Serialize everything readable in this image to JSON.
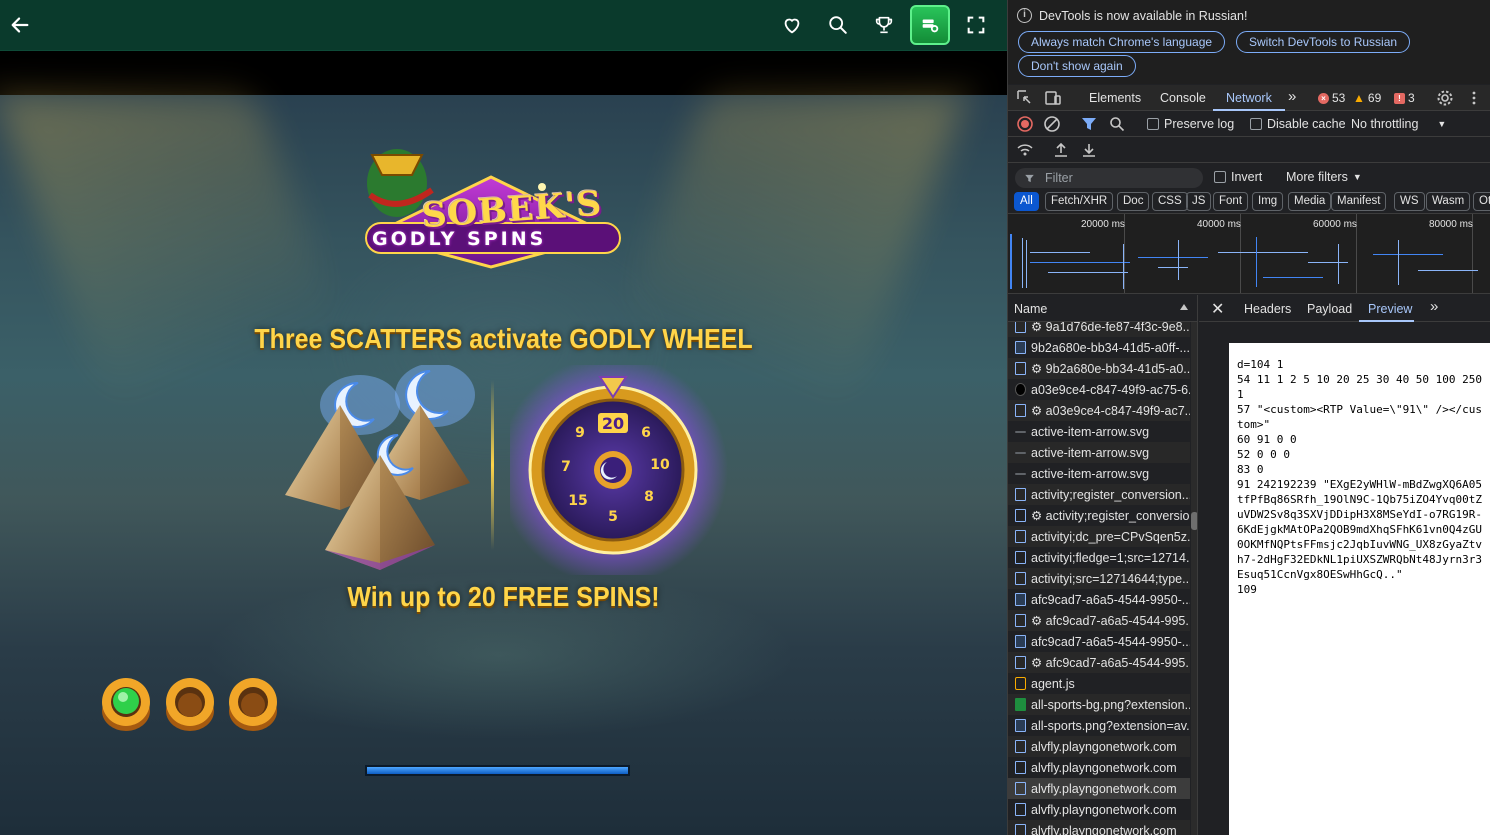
{
  "site_header": {
    "icons": [
      "back-arrow-icon",
      "heart-icon",
      "search-icon",
      "trophy-icon",
      "wallet-icon",
      "fullscreen-icon"
    ],
    "accent": "#0a3a2c",
    "wallet_color": "#1fa84a"
  },
  "game": {
    "logo_line1": "SOBEK'S",
    "logo_line2": "GODLY SPINS",
    "headline": "Three SCATTERS activate GODLY WHEEL",
    "wheel_top_value": "20",
    "wheel_values": [
      "9",
      "6",
      "10",
      "8",
      "5",
      "15",
      "7"
    ],
    "subline": "Win up to 20 FREE SPINS!",
    "tokens": [
      "green",
      "gold",
      "gold"
    ],
    "loading_progress": 1.0
  },
  "devtools": {
    "infobar": {
      "message": "DevTools is now available in Russian!",
      "button_match": "Always match Chrome's language",
      "button_switch": "Switch DevTools to Russian",
      "button_dismiss": "Don't show again"
    },
    "tabs": {
      "elements": "Elements",
      "console": "Console",
      "network": "Network",
      "errors": "53",
      "warnings": "69",
      "issues": "3"
    },
    "toolbar": {
      "preserve_log": "Preserve log",
      "disable_cache": "Disable cache",
      "throttling": "No throttling"
    },
    "filter": {
      "placeholder": "Filter",
      "invert": "Invert",
      "more_filters": "More filters"
    },
    "types": [
      "All",
      "Fetch/XHR",
      "Doc",
      "CSS",
      "JS",
      "Font",
      "Img",
      "Media",
      "Manifest",
      "WS",
      "Wasm",
      "Ot"
    ],
    "timeline_ticks": [
      "20000 ms",
      "40000 ms",
      "60000 ms",
      "80000 ms"
    ],
    "list": {
      "name_header": "Name",
      "rows": [
        {
          "icon": "doc",
          "label": "⚙ 9a1d76de-fe87-4f3c-9e8..."
        },
        {
          "icon": "img",
          "label": "9b2a680e-bb34-41d5-a0ff-..."
        },
        {
          "icon": "doc",
          "label": "⚙ 9b2a680e-bb34-41d5-a0..."
        },
        {
          "icon": "dark",
          "label": "a03e9ce4-c847-49f9-ac75-6..."
        },
        {
          "icon": "doc",
          "label": "⚙ a03e9ce4-c847-49f9-ac7..."
        },
        {
          "icon": "dash",
          "label": "active-item-arrow.svg"
        },
        {
          "icon": "dash",
          "label": "active-item-arrow.svg"
        },
        {
          "icon": "dash",
          "label": "active-item-arrow.svg"
        },
        {
          "icon": "doc",
          "label": "activity;register_conversion..."
        },
        {
          "icon": "doc",
          "label": "⚙ activity;register_conversio..."
        },
        {
          "icon": "doc",
          "label": "activityi;dc_pre=CPvSqen5z..."
        },
        {
          "icon": "doc",
          "label": "activityi;fledge=1;src=12714..."
        },
        {
          "icon": "doc",
          "label": "activityi;src=12714644;type..."
        },
        {
          "icon": "img",
          "label": "afc9cad7-a6a5-4544-9950-..."
        },
        {
          "icon": "doc",
          "label": "⚙ afc9cad7-a6a5-4544-995..."
        },
        {
          "icon": "img",
          "label": "afc9cad7-a6a5-4544-9950-..."
        },
        {
          "icon": "doc",
          "label": "⚙ afc9cad7-a6a5-4544-995..."
        },
        {
          "icon": "script",
          "label": "agent.js"
        },
        {
          "icon": "green",
          "label": "all-sports-bg.png?extension..."
        },
        {
          "icon": "img",
          "label": "all-sports.png?extension=av..."
        },
        {
          "icon": "doc",
          "label": "alvfly.playngonetwork.com"
        },
        {
          "icon": "doc",
          "label": "alvfly.playngonetwork.com"
        },
        {
          "icon": "doc",
          "label": "alvfly.playngonetwork.com"
        },
        {
          "icon": "doc",
          "label": "alvfly.playngonetwork.com"
        },
        {
          "icon": "doc",
          "label": "alvfly.playngonetwork.com"
        }
      ]
    },
    "detail": {
      "headers": "Headers",
      "payload": "Payload",
      "preview": "Preview",
      "preview_text": "d=104 1\n54 11 1 2 5 10 20 25 30 40 50 100 250 1\n57 \"<custom><RTP Value=\\\"91\\\" /></custom>\"\n60 91 0 0\n52 0 0 0\n83 0\n91 242192239 \"EXgE2yWHlW-mBdZwgXQ6A05tfPfBq86SRfh_19OlN9C-1Qb75iZO4Yvq00tZuVDW2Sv8q3SXVjDDipH3X8MSeYdI-o7RG19R-6KdEjgkMAtOPa2QOB9mdXhqSFhK61vn0Q4zGU0OKMfNQPtsFFmsjc2JqbIuvWNG_UX8zGyaZtvh7-2dHgF32EDkNL1piUXSZWRQbNt48Jyrn3r3Esuq51CcnVgx8OESwHhGcQ..\"\n109"
    }
  }
}
